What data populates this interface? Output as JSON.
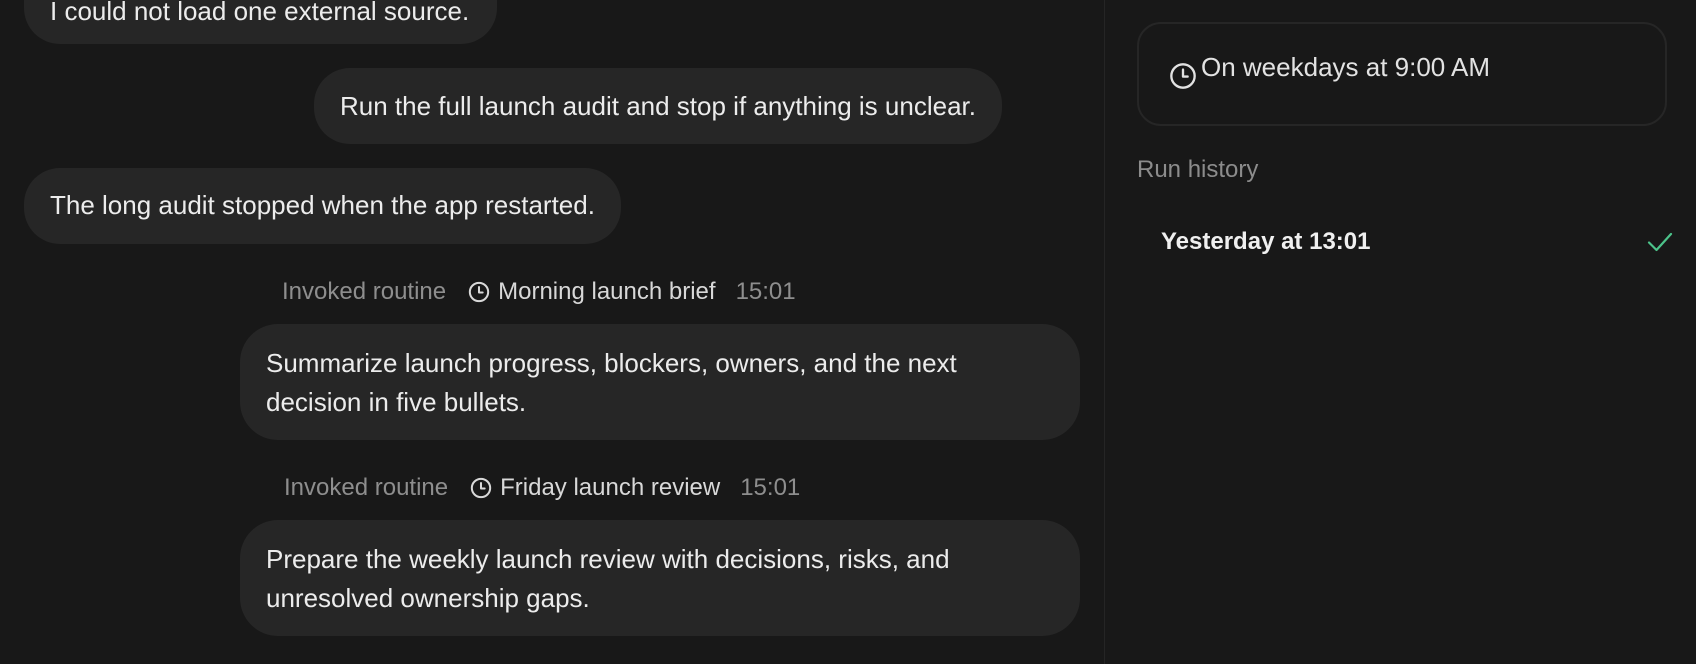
{
  "chat": {
    "messages": [
      {
        "role": "assistant",
        "text": "I could not load one external source."
      },
      {
        "role": "user",
        "text": "Run the full launch audit and stop if anything is unclear."
      },
      {
        "role": "assistant",
        "text": "The long audit stopped when the app restarted."
      },
      {
        "role": "routine",
        "invoked_label": "Invoked routine",
        "routine_name": "Morning launch brief",
        "time": "15:01",
        "icon": "clock-icon",
        "text": "Summarize launch progress, blockers, owners, and the next decision in five bullets."
      },
      {
        "role": "routine",
        "invoked_label": "Invoked routine",
        "routine_name": "Friday launch review",
        "time": "15:01",
        "icon": "clock-icon",
        "text": "Prepare the weekly launch review with decisions, risks, and unresolved ownership gaps."
      }
    ]
  },
  "sidebar": {
    "schedule": {
      "icon": "clock-icon",
      "text": "On weekdays at 9:00 AM"
    },
    "run_history": {
      "label": "Run history",
      "items": [
        {
          "label": "Yesterday at 13:01",
          "status": "success",
          "status_icon": "check-icon"
        }
      ]
    }
  },
  "colors": {
    "background": "#181818",
    "bubble": "#262626",
    "text": "#ececec",
    "muted": "#8e8e8e",
    "success": "#4cc38a"
  }
}
